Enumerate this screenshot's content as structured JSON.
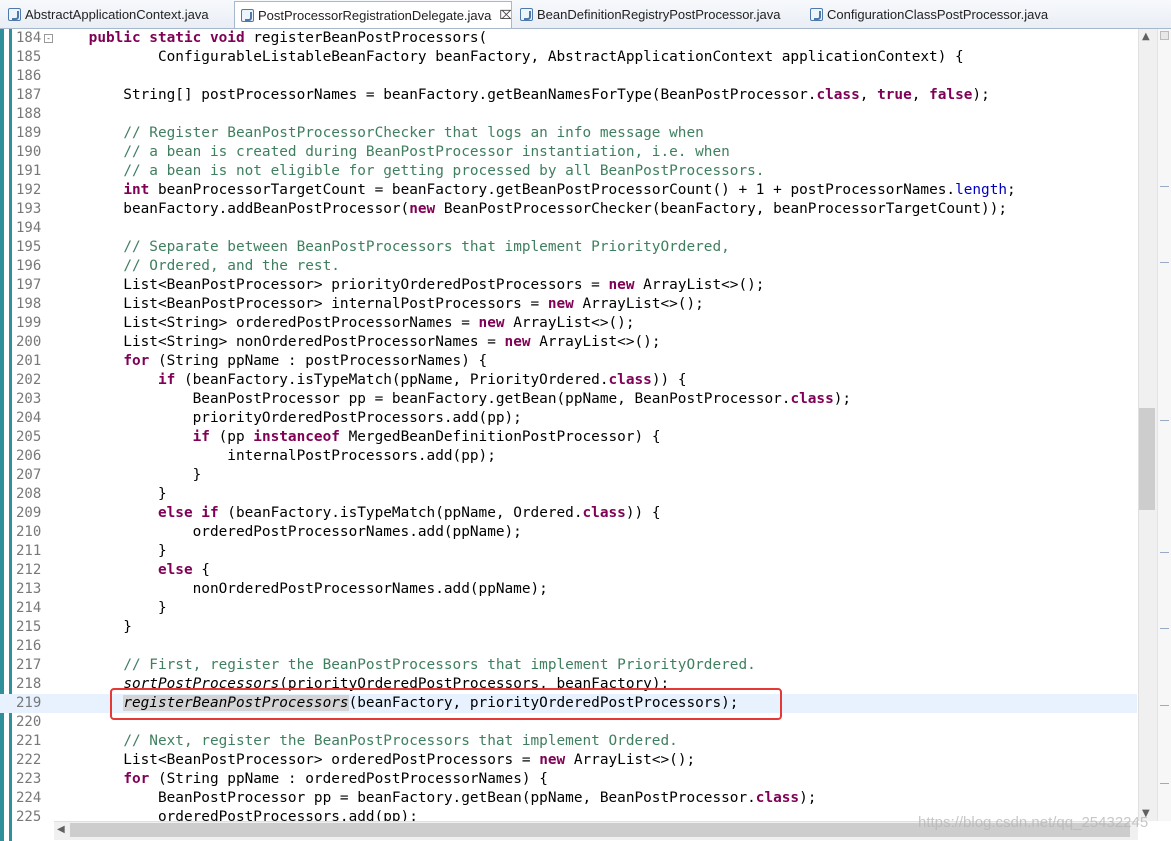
{
  "tabs": [
    {
      "label": "AbstractApplicationContext.java",
      "active": false
    },
    {
      "label": "PostProcessorRegistrationDelegate.java",
      "active": true,
      "close": "⌧"
    },
    {
      "label": "BeanDefinitionRegistryPostProcessor.java",
      "active": false
    },
    {
      "label": "ConfigurationClassPostProcessor.java",
      "active": false
    }
  ],
  "editor": {
    "current_line": 219,
    "lines": [
      {
        "n": "184",
        "fold": "-"
      },
      {
        "n": "185"
      },
      {
        "n": "186"
      },
      {
        "n": "187"
      },
      {
        "n": "188"
      },
      {
        "n": "189"
      },
      {
        "n": "190"
      },
      {
        "n": "191"
      },
      {
        "n": "192"
      },
      {
        "n": "193"
      },
      {
        "n": "194"
      },
      {
        "n": "195"
      },
      {
        "n": "196"
      },
      {
        "n": "197"
      },
      {
        "n": "198"
      },
      {
        "n": "199"
      },
      {
        "n": "200"
      },
      {
        "n": "201"
      },
      {
        "n": "202"
      },
      {
        "n": "203"
      },
      {
        "n": "204"
      },
      {
        "n": "205"
      },
      {
        "n": "206"
      },
      {
        "n": "207"
      },
      {
        "n": "208"
      },
      {
        "n": "209"
      },
      {
        "n": "210"
      },
      {
        "n": "211"
      },
      {
        "n": "212"
      },
      {
        "n": "213"
      },
      {
        "n": "214"
      },
      {
        "n": "215"
      },
      {
        "n": "216"
      },
      {
        "n": "217"
      },
      {
        "n": "218"
      },
      {
        "n": "219"
      },
      {
        "n": "220"
      },
      {
        "n": "221"
      },
      {
        "n": "222"
      },
      {
        "n": "223"
      },
      {
        "n": "224"
      },
      {
        "n": "225"
      }
    ],
    "code": [
      [
        [
          "    ",
          ""
        ],
        [
          "public static void",
          "kw"
        ],
        [
          " registerBeanPostProcessors(",
          ""
        ]
      ],
      [
        [
          "            ConfigurableListableBeanFactory beanFactory, AbstractApplicationContext applicationContext) {",
          ""
        ]
      ],
      [
        [
          "",
          ""
        ]
      ],
      [
        [
          "        String[] postProcessorNames = beanFactory.getBeanNamesForType(BeanPostProcessor.",
          ""
        ],
        [
          "class",
          "kw"
        ],
        [
          ", ",
          ""
        ],
        [
          "true",
          "kw"
        ],
        [
          ", ",
          ""
        ],
        [
          "false",
          "kw"
        ],
        [
          ");",
          ""
        ]
      ],
      [
        [
          "",
          ""
        ]
      ],
      [
        [
          "        ",
          ""
        ],
        [
          "// Register BeanPostProcessorChecker that logs an info message when",
          "cm"
        ]
      ],
      [
        [
          "        ",
          ""
        ],
        [
          "// a bean is created during BeanPostProcessor instantiation, i.e. when",
          "cm"
        ]
      ],
      [
        [
          "        ",
          ""
        ],
        [
          "// a bean is not eligible for getting processed by all BeanPostProcessors.",
          "cm"
        ]
      ],
      [
        [
          "        ",
          ""
        ],
        [
          "int",
          "kw"
        ],
        [
          " beanProcessorTargetCount = beanFactory.getBeanPostProcessorCount() + 1 + postProcessorNames.",
          ""
        ],
        [
          "length",
          "fld"
        ],
        [
          ";",
          ""
        ]
      ],
      [
        [
          "        beanFactory.addBeanPostProcessor(",
          ""
        ],
        [
          "new",
          "kw"
        ],
        [
          " BeanPostProcessorChecker(beanFactory, beanProcessorTargetCount));",
          ""
        ]
      ],
      [
        [
          "",
          ""
        ]
      ],
      [
        [
          "        ",
          ""
        ],
        [
          "// Separate between BeanPostProcessors that implement PriorityOrdered,",
          "cm"
        ]
      ],
      [
        [
          "        ",
          ""
        ],
        [
          "// Ordered, and the rest.",
          "cm"
        ]
      ],
      [
        [
          "        List<BeanPostProcessor> priorityOrderedPostProcessors = ",
          ""
        ],
        [
          "new",
          "kw"
        ],
        [
          " ArrayList<>();",
          ""
        ]
      ],
      [
        [
          "        List<BeanPostProcessor> internalPostProcessors = ",
          ""
        ],
        [
          "new",
          "kw"
        ],
        [
          " ArrayList<>();",
          ""
        ]
      ],
      [
        [
          "        List<String> orderedPostProcessorNames = ",
          ""
        ],
        [
          "new",
          "kw"
        ],
        [
          " ArrayList<>();",
          ""
        ]
      ],
      [
        [
          "        List<String> nonOrderedPostProcessorNames = ",
          ""
        ],
        [
          "new",
          "kw"
        ],
        [
          " ArrayList<>();",
          ""
        ]
      ],
      [
        [
          "        ",
          ""
        ],
        [
          "for",
          "kw"
        ],
        [
          " (String ppName : postProcessorNames) {",
          ""
        ]
      ],
      [
        [
          "            ",
          ""
        ],
        [
          "if",
          "kw"
        ],
        [
          " (beanFactory.isTypeMatch(ppName, PriorityOrdered.",
          ""
        ],
        [
          "class",
          "kw"
        ],
        [
          ")) {",
          ""
        ]
      ],
      [
        [
          "                BeanPostProcessor pp = beanFactory.getBean(ppName, BeanPostProcessor.",
          ""
        ],
        [
          "class",
          "kw"
        ],
        [
          ");",
          ""
        ]
      ],
      [
        [
          "                priorityOrderedPostProcessors.add(pp);",
          ""
        ]
      ],
      [
        [
          "                ",
          ""
        ],
        [
          "if",
          "kw"
        ],
        [
          " (pp ",
          ""
        ],
        [
          "instanceof",
          "kw"
        ],
        [
          " MergedBeanDefinitionPostProcessor) {",
          ""
        ]
      ],
      [
        [
          "                    internalPostProcessors.add(pp);",
          ""
        ]
      ],
      [
        [
          "                }",
          ""
        ]
      ],
      [
        [
          "            }",
          ""
        ]
      ],
      [
        [
          "            ",
          ""
        ],
        [
          "else if",
          "kw"
        ],
        [
          " (beanFactory.isTypeMatch(ppName, Ordered.",
          ""
        ],
        [
          "class",
          "kw"
        ],
        [
          ")) {",
          ""
        ]
      ],
      [
        [
          "                orderedPostProcessorNames.add(ppName);",
          ""
        ]
      ],
      [
        [
          "            }",
          ""
        ]
      ],
      [
        [
          "            ",
          ""
        ],
        [
          "else",
          "kw"
        ],
        [
          " {",
          ""
        ]
      ],
      [
        [
          "                nonOrderedPostProcessorNames.add(ppName);",
          ""
        ]
      ],
      [
        [
          "            }",
          ""
        ]
      ],
      [
        [
          "        }",
          ""
        ]
      ],
      [
        [
          "",
          ""
        ]
      ],
      [
        [
          "        ",
          ""
        ],
        [
          "// First, register the BeanPostProcessors that implement PriorityOrdered.",
          "cm"
        ]
      ],
      [
        [
          "        ",
          ""
        ],
        [
          "sortPostProcessors",
          "it"
        ],
        [
          "(priorityOrderedPostProcessors, beanFactory);",
          ""
        ]
      ],
      [
        [
          "        ",
          ""
        ],
        [
          "registerBeanPostProcessors",
          "it occ"
        ],
        [
          "(beanFactory, priorityOrderedPostProcessors);",
          ""
        ]
      ],
      [
        [
          "",
          ""
        ]
      ],
      [
        [
          "        ",
          ""
        ],
        [
          "// Next, register the BeanPostProcessors that implement Ordered.",
          "cm"
        ]
      ],
      [
        [
          "        List<BeanPostProcessor> orderedPostProcessors = ",
          ""
        ],
        [
          "new",
          "kw"
        ],
        [
          " ArrayList<>();",
          ""
        ]
      ],
      [
        [
          "        ",
          ""
        ],
        [
          "for",
          "kw"
        ],
        [
          " (String ppName : orderedPostProcessorNames) {",
          ""
        ]
      ],
      [
        [
          "            BeanPostProcessor pp = beanFactory.getBean(ppName, BeanPostProcessor.",
          ""
        ],
        [
          "class",
          "kw"
        ],
        [
          ");",
          ""
        ]
      ],
      [
        [
          "            orderedPostProcessors.add(pp);",
          ""
        ]
      ]
    ]
  },
  "scrollbars": {
    "up_arrow": "▲",
    "down_arrow": "▼",
    "left_arrow": "◀",
    "right_arrow": "▶"
  },
  "watermark": "https://blog.csdn.net/qq_25432245"
}
